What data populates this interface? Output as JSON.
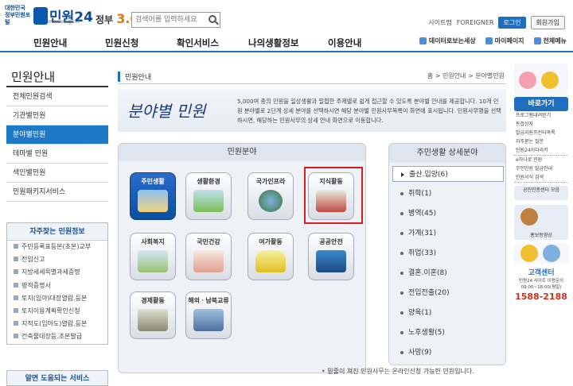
{
  "header": {
    "logo_gov": "대한민국 정부민원포털",
    "logo_title": "민원24",
    "logo_url": "minwon.go.kr",
    "gov30_label": "정부",
    "gov30_num": "3.0",
    "search_placeholder": "검색어를 입력하세요",
    "sitemap": "사이트맵",
    "foreigner": "FOREIGNER",
    "login": "로그인",
    "join": "회원가입"
  },
  "gnb": {
    "items": [
      "민원안내",
      "민원신청",
      "확인서비스",
      "나의생활정보",
      "이용안내"
    ],
    "right": [
      "데이터로보는세상",
      "마이페이지",
      "전체메뉴"
    ]
  },
  "lnb": {
    "title": "민원안내",
    "items": [
      "전체민원검색",
      "기관별민원",
      "분야별민원",
      "테마별 민원",
      "색인별민원",
      "민원패키지서비스"
    ],
    "active_index": 2
  },
  "freq": {
    "title": "자주찾는 민원정보",
    "items": [
      "주민등록표등본(초본)교부",
      "전입신고",
      "지방세세목별과세증명",
      "병적증명서",
      "토지(임야)대장열람.등본",
      "토지이용계획확인신청",
      "지적도(임야도)열람.등본",
      "건축물대장등.초본발급"
    ]
  },
  "help": {
    "title": "알면 도움되는 서비스"
  },
  "main": {
    "page_label": "민원안내",
    "crumbs": "홈 > 민원안내 > 분야별민원",
    "banner_title": "분야별 민원",
    "banner_desc": "5,000여 종의 민원을 일상생활과 밀접한 주제별로 쉽게 접근할 수 있도록 분야별 안내를 제공합니다. 10개 민원 분야별로 2단계 상세 분야를 선택하시면 해당 분야별 민원사무목록이 화면에 표시됩니다. 민원사무명을 선택하시면, 해당하는 민원사무의 상세 안내 화면으로 이동합니다.",
    "cat_header": "민원분야",
    "categories": [
      "주민생활",
      "생활환경",
      "국가인프라",
      "지식활동",
      "사회복지",
      "국민건강",
      "여가활동",
      "공공안전",
      "경제활동",
      "해외ㆍ남북교류"
    ],
    "sub_header": "주민생활 상세분야",
    "sub_items": [
      "출산.입양(6)",
      "취학(1)",
      "병역(45)",
      "가계(31)",
      "취업(33)",
      "결혼.이혼(8)",
      "전입전출(20)",
      "양육(1)",
      "노후생활(5)",
      "사망(9)"
    ],
    "note": "• 밑줄이 쳐진 민원사무는 온라인신청 가능한 민원입니다."
  },
  "right": {
    "quick_title": "바로가기",
    "quick_items": [
      "프로그램내려받기",
      "동합상자",
      "발급지원프린터목록",
      "자주묻는 질문",
      "민원24이다라키"
    ],
    "service_items": [
      "e하나로 민원",
      "무인민원 발급안내",
      "민원서식 검색"
    ],
    "promo1": "공인인증센터 모음",
    "promo2": "홍보동영상",
    "call_title": "고객센터",
    "call_sub": "민원24 사이트 이용문의",
    "call_hours": "09:00~18:00(평일)",
    "call_num": "1588-2188"
  },
  "colors": {
    "accent": "#1e6fc0",
    "active_tab": "#1e78c8",
    "highlight_frame": "#d02020"
  }
}
